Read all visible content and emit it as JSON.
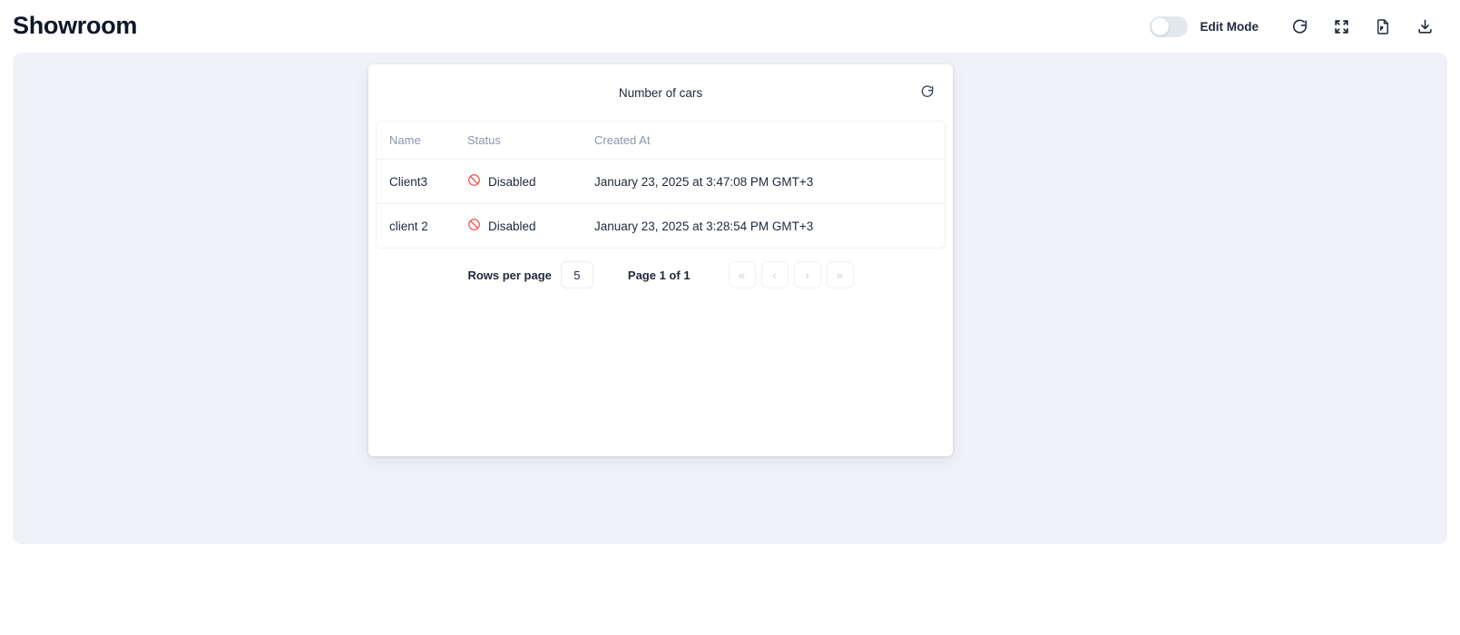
{
  "header": {
    "title": "Showroom",
    "toggle": {
      "name": "edit-mode-toggle",
      "state": "off"
    },
    "edit_mode_label": "Edit Mode",
    "actions": [
      {
        "icon": "refresh-icon",
        "label": "Refresh"
      },
      {
        "icon": "fullscreen-icon",
        "label": "Fullscreen"
      },
      {
        "icon": "pdf-file-icon",
        "label": "Export PDF"
      },
      {
        "icon": "download-icon",
        "label": "Download"
      }
    ]
  },
  "card": {
    "title": "Number of cars",
    "refresh_icon": "refresh-icon",
    "table": {
      "columns": [
        "Name",
        "Status",
        "Created At"
      ],
      "rows": [
        {
          "name": "Client3",
          "status": "Disabled",
          "status_icon": "ban-icon",
          "created_at": "January 23, 2025 at 3:47:08 PM GMT+3"
        },
        {
          "name": "client 2",
          "status": "Disabled",
          "status_icon": "ban-icon",
          "created_at": "January 23, 2025 at 3:28:54 PM GMT+3"
        }
      ]
    },
    "pagination": {
      "rows_per_page_label": "Rows per page",
      "rows_per_page_value": "5",
      "page_label": "Page 1 of 1",
      "first_page": "«",
      "prev_page": "‹",
      "next_page": "›",
      "last_page": "»"
    }
  },
  "colors": {
    "title": "#0f1729",
    "canvas_bg": "#f0f2f7",
    "card_bg": "#ffffff",
    "status_red": "#ef5350",
    "header_text": "#8a95ad",
    "body_text": "#1e293b",
    "toggle_track": "#e3e7ee"
  }
}
